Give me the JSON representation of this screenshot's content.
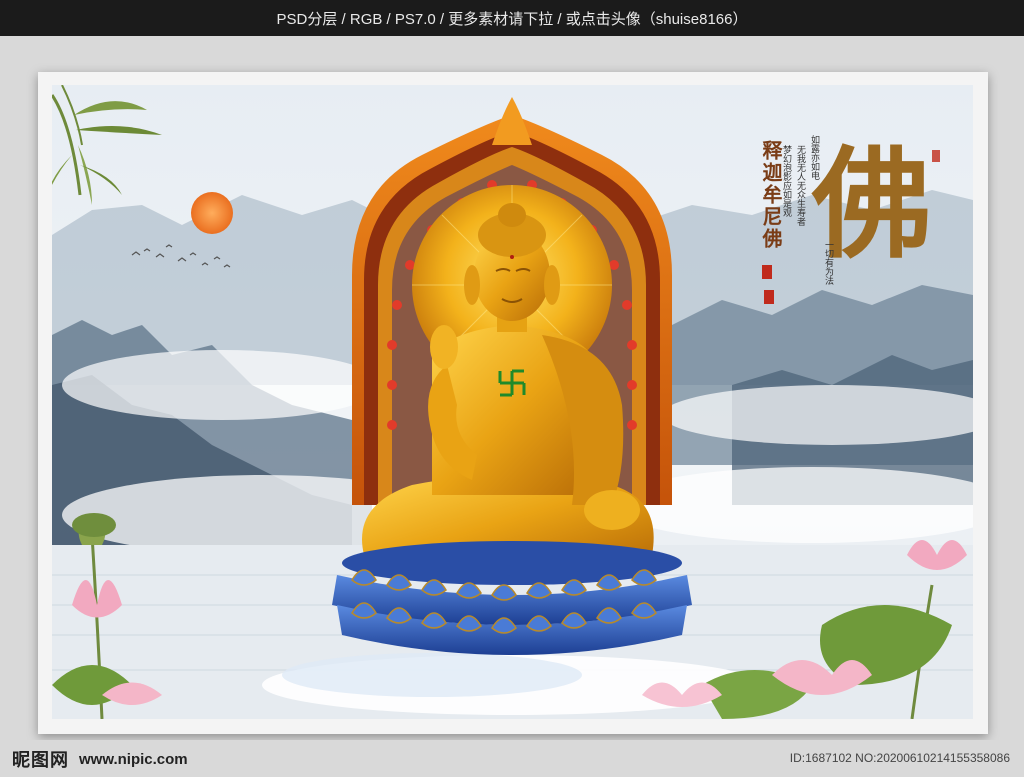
{
  "header": {
    "banner": "PSD分层 / RGB / PS7.0 / 更多素材请下拉 / 或点击头像（shuise8166）"
  },
  "poster": {
    "title_char": "佛",
    "subtitle": "释迦牟尼佛",
    "poem": [
      "如露亦如电",
      "无我无人无众生寿者",
      "梦幻泡影应如是观",
      "一切有为法"
    ],
    "colors": {
      "gold": "#e5a10f",
      "calligraphy": "#9b6a22",
      "lotus_blue": "#2f5fc0",
      "sun": "#f08a38",
      "mountain": "#5d7489"
    }
  },
  "footer": {
    "logo_text": "昵图网",
    "url": "www.nipic.com",
    "id_text": "ID:1687102 NO:20200610214155358086"
  }
}
